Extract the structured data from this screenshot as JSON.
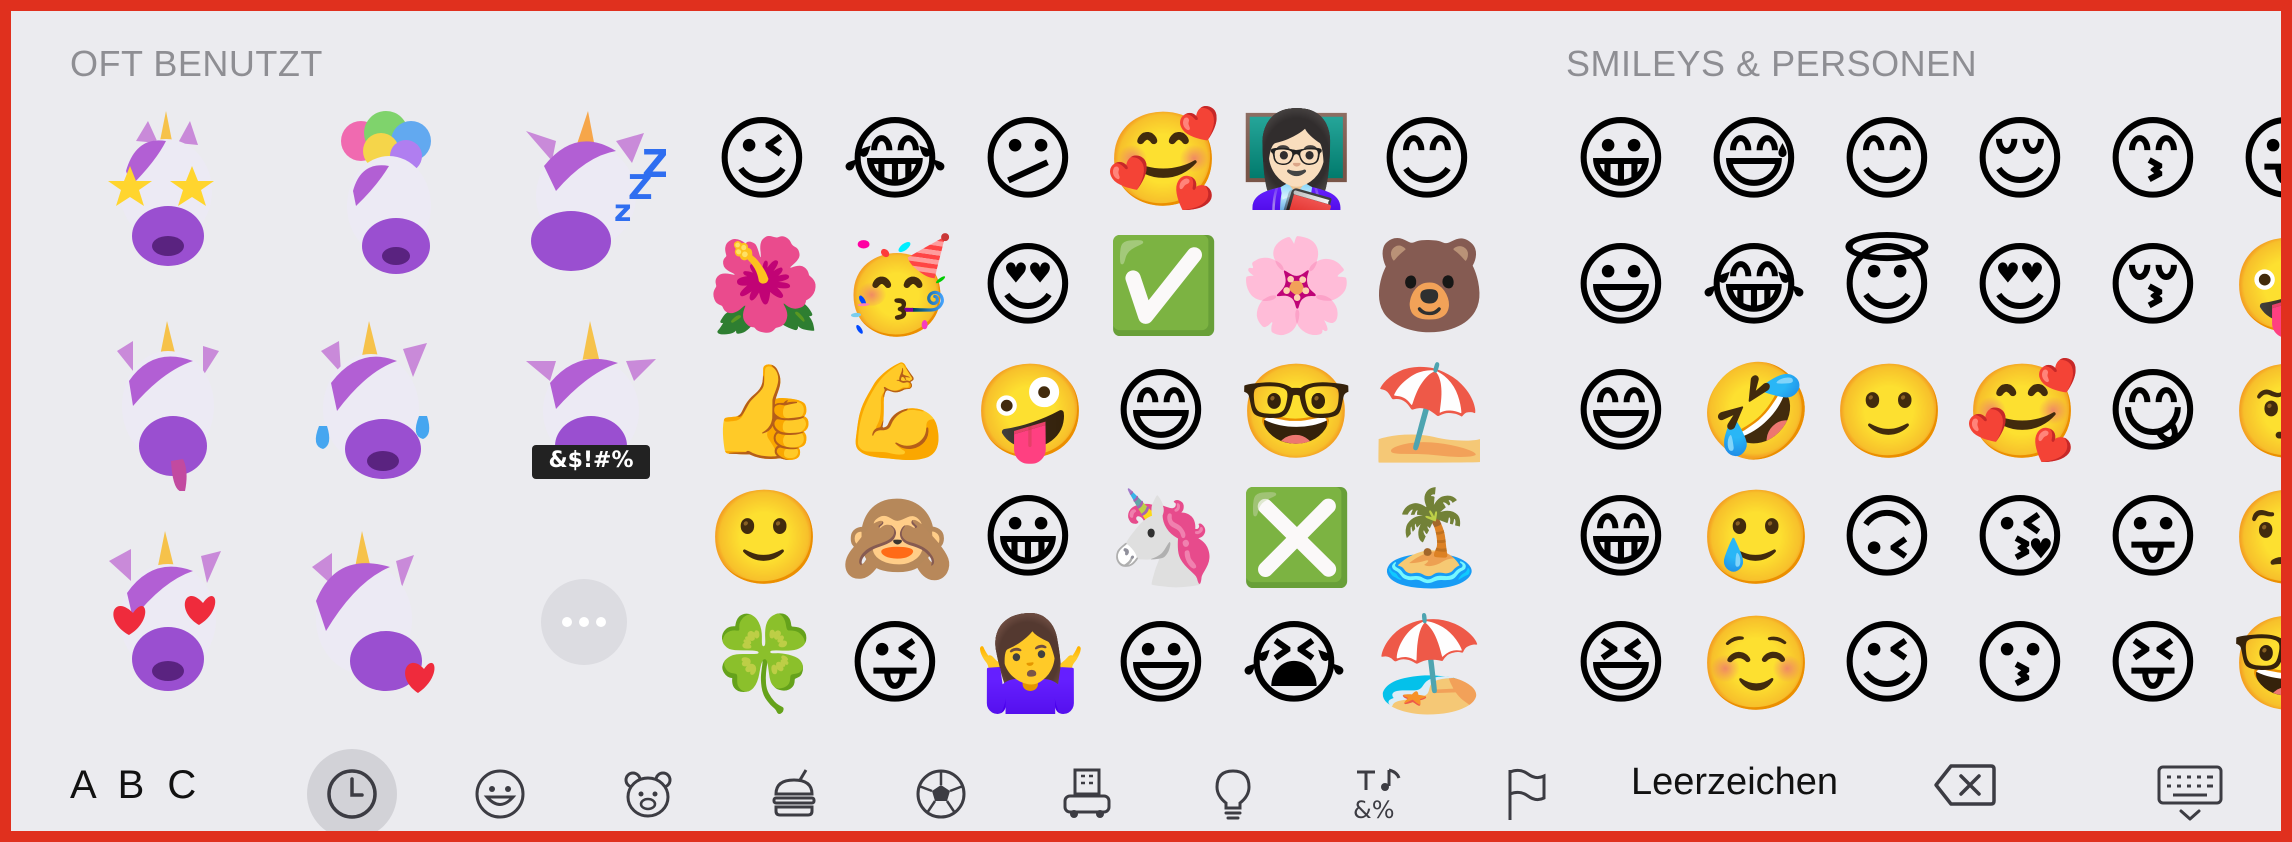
{
  "sections": {
    "frequent_title": "OFT BENUTZT",
    "smileys_title": "SMILEYS & PERSONEN"
  },
  "stickers": [
    {
      "name": "unicorn-star-eyes-sticker",
      "mood": "star-struck"
    },
    {
      "name": "unicorn-mind-blown-sticker",
      "mood": "mind-blown"
    },
    {
      "name": "unicorn-sleeping-sticker",
      "mood": "sleeping",
      "zzz": "zZZ"
    },
    {
      "name": "unicorn-tongue-out-sticker",
      "mood": "tongue"
    },
    {
      "name": "unicorn-laughing-tears-sticker",
      "mood": "laughing"
    },
    {
      "name": "unicorn-cursing-sticker",
      "mood": "cursing",
      "caption": "&$!#%"
    },
    {
      "name": "unicorn-heart-eyes-sticker",
      "mood": "heart-eyes"
    },
    {
      "name": "unicorn-heart-kiss-sticker",
      "mood": "kiss"
    }
  ],
  "frequent_emojis": [
    "😉",
    "😂",
    "😕",
    "🥰",
    "👩🏻‍🏫",
    "😊",
    "🌺",
    "🥳",
    "😍",
    "✅",
    "🌸",
    "🐻",
    "👍",
    "💪",
    "🤪",
    "😄",
    "🤓",
    "⛱️",
    "🙂",
    "🙈",
    "😀",
    "🦄",
    "❎",
    "🏝️",
    "🍀",
    "😜",
    "🤷‍♀️",
    "😃",
    "😭",
    "🏖️"
  ],
  "smiley_emojis": [
    "😀",
    "😅",
    "😊",
    "😌",
    "😙",
    "😛",
    "😃",
    "😂",
    "😇",
    "😍",
    "😚",
    "🤪",
    "😄",
    "🤣",
    "🙂",
    "🥰",
    "😋",
    "🤨",
    "😁",
    "🥲",
    "🙃",
    "😘",
    "😛",
    "🧐",
    "😆",
    "☺️",
    "😉",
    "😗",
    "😝",
    "🤓"
  ],
  "bottom_bar": {
    "abc_label": "A B C",
    "space_label": "Leerzeichen",
    "categories": [
      {
        "name": "recent",
        "icon": "clock-icon",
        "active": true
      },
      {
        "name": "smileys",
        "icon": "smiley-icon",
        "active": false
      },
      {
        "name": "animals",
        "icon": "bear-icon",
        "active": false
      },
      {
        "name": "food",
        "icon": "burger-icon",
        "active": false
      },
      {
        "name": "activity",
        "icon": "soccer-ball-icon",
        "active": false
      },
      {
        "name": "travel",
        "icon": "buildings-car-icon",
        "active": false
      },
      {
        "name": "objects",
        "icon": "lightbulb-icon",
        "active": false
      },
      {
        "name": "symbols",
        "icon": "symbols-icon",
        "active": false
      },
      {
        "name": "flags",
        "icon": "flag-icon",
        "active": false
      }
    ],
    "delete_icon": "backspace-icon",
    "dismiss_icon": "keyboard-dismiss-icon"
  },
  "colors": {
    "frame": "#e0301e",
    "background": "#ebebef",
    "header_text": "#8e8e93",
    "icon": "#3c3c43",
    "active_pill": "#d2d2d7"
  }
}
